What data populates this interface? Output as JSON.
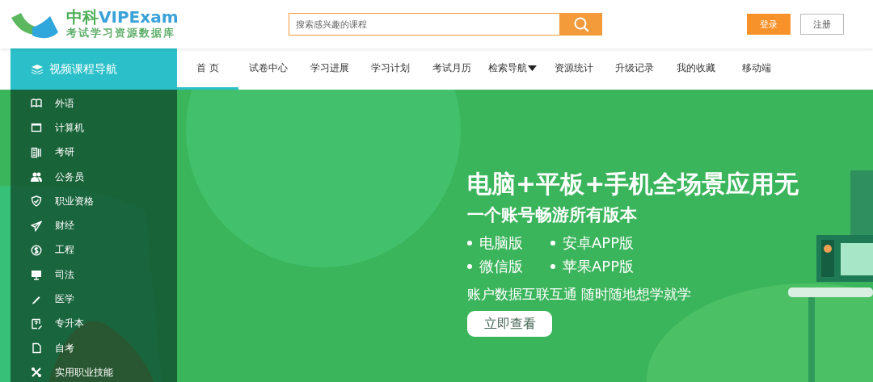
{
  "logo": {
    "brand_cn": "中科",
    "brand_en": "VIPExam",
    "tagline": "考试学习资源数据库"
  },
  "search": {
    "placeholder": "搜索感兴趣的课程"
  },
  "auth_buttons": [
    {
      "label": "登录",
      "kind": "primary"
    },
    {
      "label": "注册",
      "kind": "secondary"
    }
  ],
  "nav": {
    "title": "视频课程导航",
    "tabs": [
      {
        "label": "首 页",
        "selected": true,
        "dropdown": false
      },
      {
        "label": "试卷中心",
        "selected": false,
        "dropdown": false
      },
      {
        "label": "学习进展",
        "selected": false,
        "dropdown": false
      },
      {
        "label": "学习计划",
        "selected": false,
        "dropdown": false
      },
      {
        "label": "考试月历",
        "selected": false,
        "dropdown": false
      },
      {
        "label": "检索导航",
        "selected": false,
        "dropdown": true
      },
      {
        "label": "资源统计",
        "selected": false,
        "dropdown": false
      },
      {
        "label": "升级记录",
        "selected": false,
        "dropdown": false
      },
      {
        "label": "我的收藏",
        "selected": false,
        "dropdown": false
      },
      {
        "label": "移动端",
        "selected": false,
        "dropdown": false
      }
    ]
  },
  "categories": [
    {
      "label": "外语"
    },
    {
      "label": "计算机"
    },
    {
      "label": "考研"
    },
    {
      "label": "公务员"
    },
    {
      "label": "职业资格"
    },
    {
      "label": "财经"
    },
    {
      "label": "工程"
    },
    {
      "label": "司法"
    },
    {
      "label": "医学"
    },
    {
      "label": "专升本"
    },
    {
      "label": "自考"
    },
    {
      "label": "实用职业技能"
    }
  ],
  "banner": {
    "headline": "电脑+平板+手机全场景应用无",
    "subheadline": "一个账号畅游所有版本",
    "features": [
      "电脑版",
      "安卓APP版",
      "微信版",
      "苹果APP版"
    ],
    "tagline": "账户数据互联互通 随时随地想学就学",
    "button": "立即查看"
  }
}
